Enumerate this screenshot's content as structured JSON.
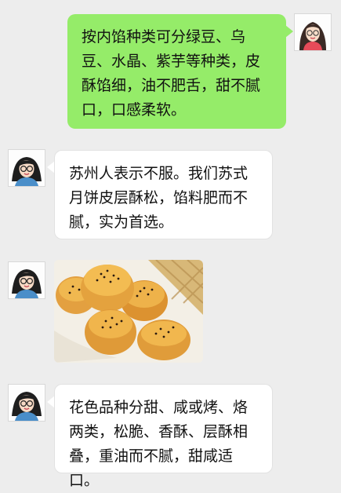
{
  "messages": [
    {
      "from": "female-user",
      "text": "按内馅种类可分绿豆、乌豆、水晶、紫芋等种类，皮酥馅细，油不肥舌，甜不腻口，口感柔软。"
    },
    {
      "from": "male-user",
      "text": "苏州人表示不服。我们苏式月饼皮层酥松，馅料肥而不腻，实为首选。"
    },
    {
      "from": "male-user",
      "image": "mooncake-photo"
    },
    {
      "from": "male-user",
      "text": "花色品种分甜、咸或烤、烙两类，松脆、香酥、层酥相叠，重油而不腻，甜咸适口。"
    }
  ],
  "colors": {
    "background": "#ededed",
    "sent_bubble": "#95ec69",
    "received_bubble": "#ffffff"
  }
}
